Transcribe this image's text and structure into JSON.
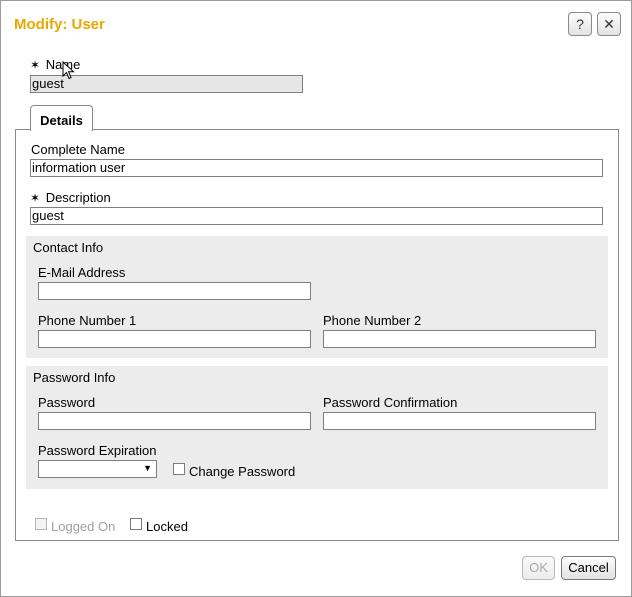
{
  "dialog": {
    "title": "Modify: User",
    "help_label": "?",
    "close_label": "✕"
  },
  "name_field": {
    "label": "Name",
    "value": "guest",
    "required_mark": "✶"
  },
  "tabs": [
    {
      "label": "Details"
    }
  ],
  "details": {
    "complete_name": {
      "label": "Complete Name",
      "value": "information user"
    },
    "description": {
      "label": "Description",
      "value": "guest",
      "required_mark": "✶"
    }
  },
  "contact_info": {
    "heading": "Contact Info",
    "email_label": "E-Mail Address",
    "email_value": "",
    "phone1_label": "Phone Number 1",
    "phone1_value": "",
    "phone2_label": "Phone Number 2",
    "phone2_value": ""
  },
  "password_info": {
    "heading": "Password Info",
    "password_label": "Password",
    "password_value": "",
    "confirmation_label": "Password Confirmation",
    "confirmation_value": "",
    "expiration_label": "Password Expiration",
    "expiration_value": "",
    "change_password_label": "Change Password",
    "change_password_checked": false
  },
  "flags": {
    "logged_on_label": "Logged On",
    "logged_on_checked": false,
    "locked_label": "Locked",
    "locked_checked": false
  },
  "buttons": {
    "ok_label": "OK",
    "cancel_label": "Cancel"
  },
  "colors": {
    "title": "#e8a800",
    "section_bg": "#ececec",
    "readonly_bg": "#e6e6e6"
  }
}
